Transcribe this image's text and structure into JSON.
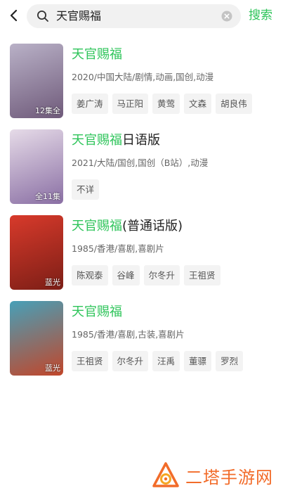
{
  "search": {
    "query": "天官赐福",
    "button_label": "搜索"
  },
  "results": [
    {
      "title_highlight": "天官赐福",
      "title_rest": "",
      "meta": "2020/中国大陆/剧情,动画,国创,动漫",
      "poster_badge": "12集全",
      "tags": [
        "姜广涛",
        "马正阳",
        "黄莺",
        "文森",
        "胡良伟"
      ],
      "poster_colors": [
        "#b9b1c7",
        "#6f5a7a"
      ]
    },
    {
      "title_highlight": "天官赐福",
      "title_rest": "日语版",
      "meta": "2021/大陆/国创,国创（B站）,动漫",
      "poster_badge": "全11集",
      "tags": [
        "不详"
      ],
      "poster_colors": [
        "#e6dbe8",
        "#8a6fa4"
      ]
    },
    {
      "title_highlight": "天官赐福",
      "title_rest": "(普通话版)",
      "meta": "1985/香港/喜剧,喜剧片",
      "poster_badge": "蓝光",
      "tags": [
        "陈观泰",
        "谷峰",
        "尔冬升",
        "王祖贤"
      ],
      "poster_colors": [
        "#d83a2b",
        "#7c1e16"
      ]
    },
    {
      "title_highlight": "天官赐福",
      "title_rest": "",
      "meta": "1985/香港/喜剧,古装,喜剧片",
      "poster_badge": "蓝光",
      "tags": [
        "王祖贤",
        "尔冬升",
        "汪禹",
        "董骠",
        "罗烈"
      ],
      "poster_colors": [
        "#47a0b8",
        "#c2462a"
      ]
    }
  ],
  "watermark": {
    "text": "二塔手游网"
  },
  "colors": {
    "accent": "#2ec45a",
    "watermark": "#f26c2a"
  }
}
